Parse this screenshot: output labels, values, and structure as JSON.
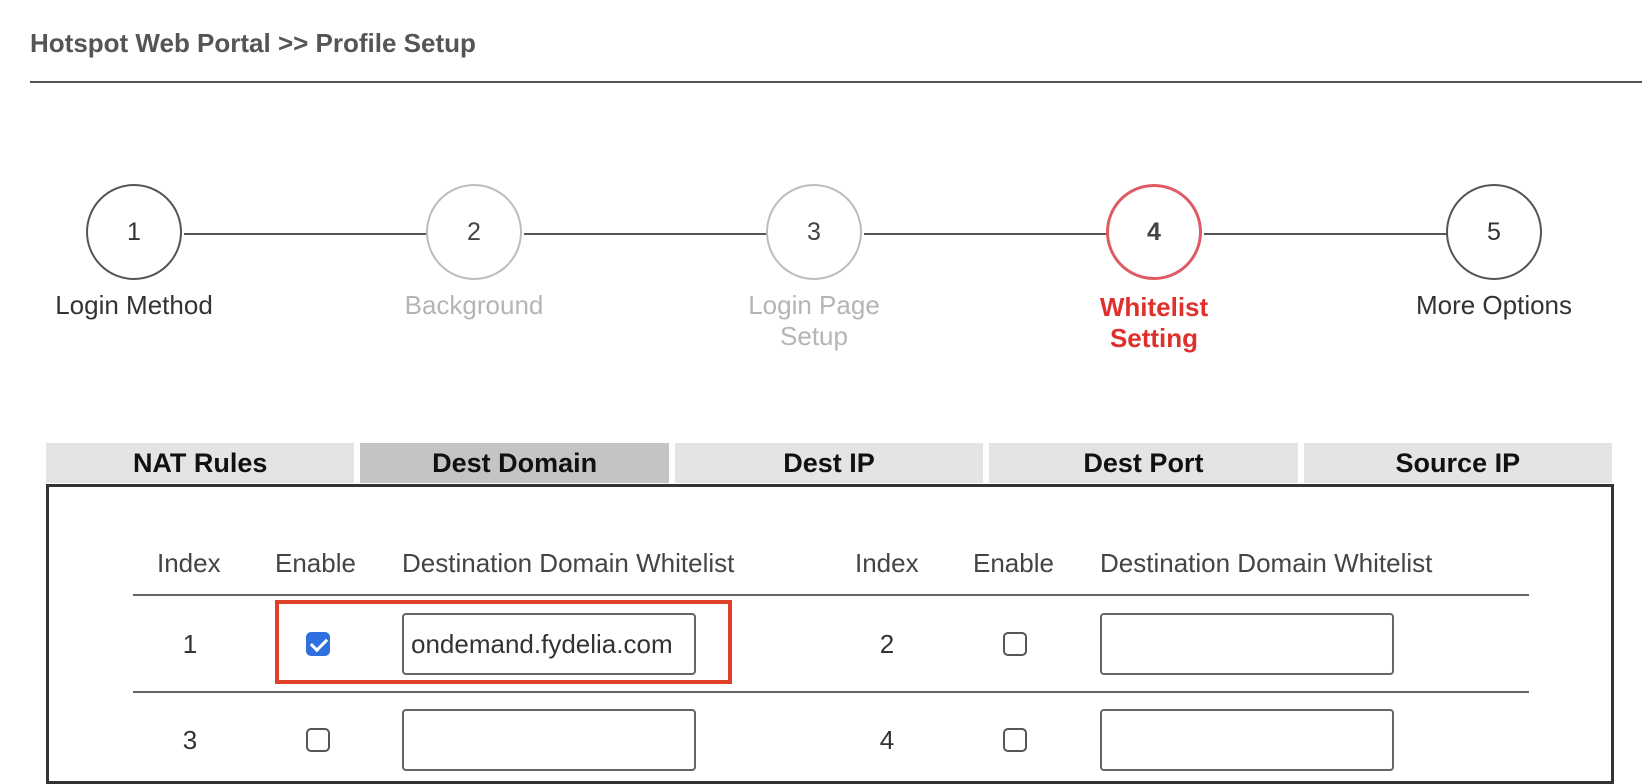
{
  "header": {
    "breadcrumb": "Hotspot Web Portal >> Profile Setup"
  },
  "wizard": {
    "current_step": 4,
    "steps": [
      {
        "number": "1",
        "label": "Login Method",
        "state": "done"
      },
      {
        "number": "2",
        "label": "Background",
        "state": "disabled"
      },
      {
        "number": "3",
        "label": "Login Page Setup",
        "state": "disabled"
      },
      {
        "number": "4",
        "label": "Whitelist Setting",
        "state": "active"
      },
      {
        "number": "5",
        "label": "More Options",
        "state": "done"
      }
    ]
  },
  "tabs": {
    "selected": "Dest Domain",
    "items": [
      "NAT Rules",
      "Dest Domain",
      "Dest IP",
      "Dest Port",
      "Source IP"
    ]
  },
  "table": {
    "columns": {
      "index": "Index",
      "enable": "Enable",
      "domain": "Destination Domain Whitelist"
    },
    "rows": [
      [
        {
          "index": "1",
          "enabled": true,
          "domain": "ondemand.fydelia.com"
        },
        {
          "index": "2",
          "enabled": false,
          "domain": ""
        }
      ],
      [
        {
          "index": "3",
          "enabled": false,
          "domain": ""
        },
        {
          "index": "4",
          "enabled": false,
          "domain": ""
        }
      ]
    ]
  },
  "colors": {
    "active_step": "#e0302b",
    "active_step_ring": "#e05a63",
    "highlight_box": "#e0402a",
    "checkbox_checked": "#2f6fe0",
    "tab_selected": "#c4c4c4",
    "tab_default": "#e4e4e4"
  }
}
